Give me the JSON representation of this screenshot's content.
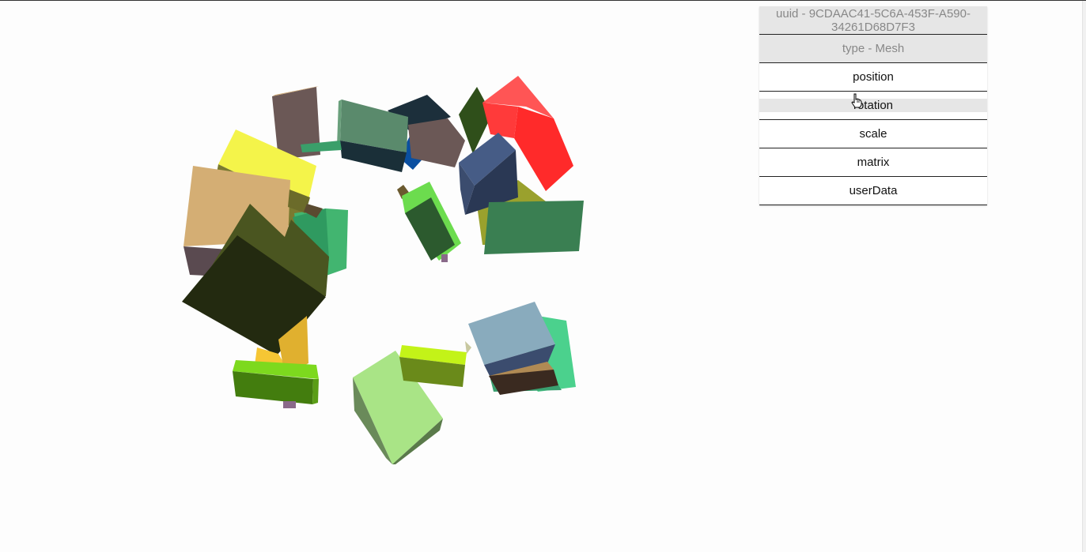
{
  "inspector": {
    "uuid_text": "uuid - 9CDAAC41-5C6A-453F-A590-34261D68D7F3",
    "type_text": "type - Mesh",
    "properties": [
      "position",
      "rotation",
      "scale",
      "matrix",
      "userData"
    ],
    "hovered_property": "rotation"
  },
  "scene": {
    "object_type": "Mesh",
    "cube_colors": [
      "#d4ae74",
      "#f4f44a",
      "#6b5856",
      "#5a8a6c",
      "#ff3a3a",
      "#3b4c6e",
      "#9aa12d",
      "#3a7f52",
      "#6cdc4e",
      "#89abbd",
      "#4bd18d",
      "#a9e486",
      "#c3f318",
      "#7dd91e",
      "#f6c634",
      "#2a3014",
      "#42b570",
      "#2f4f1a",
      "#7a665f",
      "#3a2a20"
    ]
  },
  "cursor": {
    "icon": "hand-pointer-icon"
  }
}
